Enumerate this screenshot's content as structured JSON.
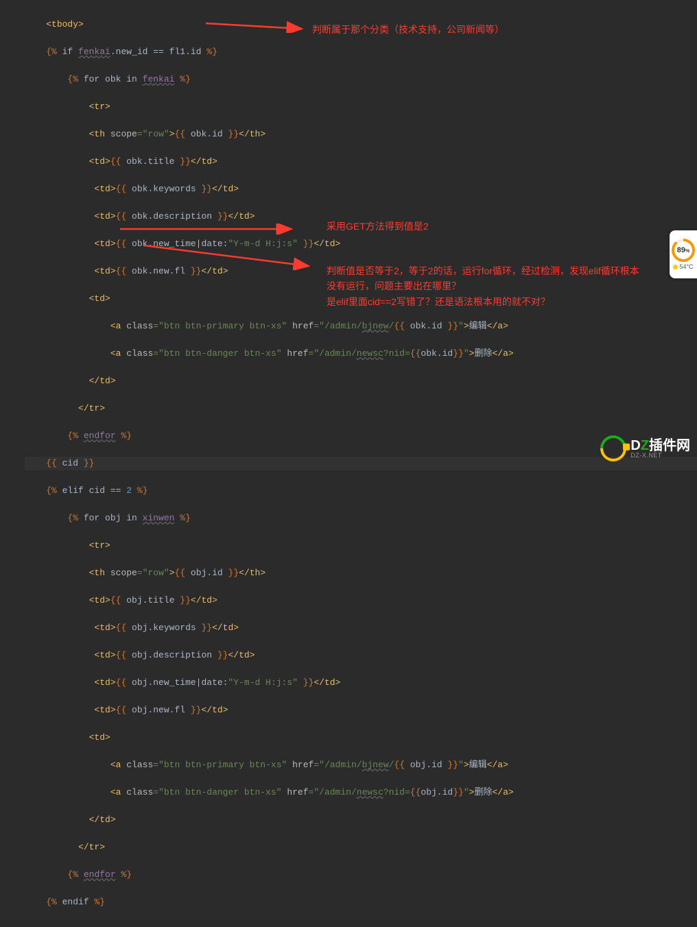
{
  "annotations": {
    "a1": "判断属于那个分类（技术支持，公司新闻等）",
    "a2": "采用GET方法得到值是2",
    "a3_l1": "判断值是否等于2，等于2的话，运行for循环，经过检测，发现elif循环根本",
    "a3_l2": "没有运行，问题主要出在哪里？",
    "a3_l3": "是elif里面cid==2写错了？还是语法根本用的就不对？"
  },
  "weather": {
    "score": "89",
    "unit": "%",
    "temp": "54°C"
  },
  "brand": {
    "main_pre": "D",
    "main_z": "Z",
    "main_post": "插件网",
    "sub": "DZ-X.NET"
  },
  "code": {
    "l1": "<tbody>",
    "l2_a": "{%",
    "l2_b": " if ",
    "l2_c": "fenkai",
    "l2_d": ".new_id == fl1.id ",
    "l2_e": "%}",
    "l3_a": "{%",
    "l3_b": " for obk in ",
    "l3_c": "fenkai",
    "l3_d": " ",
    "l3_e": "%}",
    "l4": "<tr>",
    "l5_a": "<th ",
    "l5_b": "scope",
    "l5_c": "=",
    "l5_d": "\"row\"",
    "l5_e": ">",
    "l5_f": "{{",
    "l5_g": " obk.id ",
    "l5_h": "}}",
    "l5_i": "</th>",
    "l6_a": "<td>",
    "l6_b": "{{",
    "l6_c": " obk.title ",
    "l6_d": "}}",
    "l6_e": "</td>",
    "l7_a": "<td>",
    "l7_b": "{{",
    "l7_c": " obk.keywords ",
    "l7_d": "}}",
    "l7_e": "</td>",
    "l8_a": "<td>",
    "l8_b": "{{",
    "l8_c": " obk.description ",
    "l8_d": "}}",
    "l8_e": "</td>",
    "l9_a": "<td>",
    "l9_b": "{{",
    "l9_c": " obk.new_time|date:",
    "l9_d": "\"Y-m-d H:j:s\"",
    "l9_e": " ",
    "l9_f": "}}",
    "l9_g": "</td>",
    "l10_a": "<td>",
    "l10_b": "{{",
    "l10_c": " obk.new.fl ",
    "l10_d": "}}",
    "l10_e": "</td>",
    "l11": "<td>",
    "l12_a": "<a ",
    "l12_b": "class",
    "l12_c": "=",
    "l12_d": "\"btn btn-primary btn-xs\"",
    "l12_e": " ",
    "l12_f": "href",
    "l12_g": "=",
    "l12_h": "\"/admin/",
    "l12_i": "bjnew",
    "l12_j": "/",
    "l12_k": "{{",
    "l12_l": " obk.id ",
    "l12_m": "}}",
    "l12_n": "\"",
    "l12_o": ">",
    "l12_p": "编辑",
    "l12_q": "</a>",
    "l13_a": "<a ",
    "l13_b": "class",
    "l13_c": "=",
    "l13_d": "\"btn btn-danger btn-xs\"",
    "l13_e": " ",
    "l13_f": "href",
    "l13_g": "=",
    "l13_h": "\"/admin/",
    "l13_i": "newsc",
    "l13_j": "?nid=",
    "l13_k": "{{",
    "l13_l": "obk.id",
    "l13_m": "}}",
    "l13_n": "\"",
    "l13_o": ">",
    "l13_p": "删除",
    "l13_q": "</a>",
    "l14": "</td>",
    "l15": "</tr>",
    "l16_a": "{%",
    "l16_b": " ",
    "l16_c": "endfor",
    "l16_d": " ",
    "l16_e": "%}",
    "l17_a": "{{",
    "l17_b": " cid ",
    "l17_c": "}}",
    "l18_a": "{%",
    "l18_b": " elif cid == ",
    "l18_c": "2",
    "l18_d": " ",
    "l18_e": "%}",
    "l19_a": "{%",
    "l19_b": " for obj in ",
    "l19_c": "xinwen",
    "l19_d": " ",
    "l19_e": "%}",
    "l20": "<tr>",
    "l21_a": "<th ",
    "l21_b": "scope",
    "l21_c": "=",
    "l21_d": "\"row\"",
    "l21_e": ">",
    "l21_f": "{{",
    "l21_g": " obj.id ",
    "l21_h": "}}",
    "l21_i": "</th>",
    "l22_a": "<td>",
    "l22_b": "{{",
    "l22_c": " obj.title ",
    "l22_d": "}}",
    "l22_e": "</td>",
    "l23_a": "<td>",
    "l23_b": "{{",
    "l23_c": " obj.keywords ",
    "l23_d": "}}",
    "l23_e": "</td>",
    "l24_a": "<td>",
    "l24_b": "{{",
    "l24_c": " obj.description ",
    "l24_d": "}}",
    "l24_e": "</td>",
    "l25_a": "<td>",
    "l25_b": "{{",
    "l25_c": " obj.new_time|date:",
    "l25_d": "\"Y-m-d H:j:s\"",
    "l25_e": " ",
    "l25_f": "}}",
    "l25_g": "</td>",
    "l26_a": "<td>",
    "l26_b": "{{",
    "l26_c": " obj.new.fl ",
    "l26_d": "}}",
    "l26_e": "</td>",
    "l27": "<td>",
    "l28_a": "<a ",
    "l28_b": "class",
    "l28_c": "=",
    "l28_d": "\"btn btn-primary btn-xs\"",
    "l28_e": " ",
    "l28_f": "href",
    "l28_g": "=",
    "l28_h": "\"/admin/",
    "l28_i": "bjnew",
    "l28_j": "/",
    "l28_k": "{{",
    "l28_l": " obj.id ",
    "l28_m": "}}",
    "l28_n": "\"",
    "l28_o": ">",
    "l28_p": "编辑",
    "l28_q": "</a>",
    "l29_a": "<a ",
    "l29_b": "class",
    "l29_c": "=",
    "l29_d": "\"btn btn-danger btn-xs\"",
    "l29_e": " ",
    "l29_f": "href",
    "l29_g": "=",
    "l29_h": "\"/admin/",
    "l29_i": "newsc",
    "l29_j": "?nid=",
    "l29_k": "{{",
    "l29_l": "obj.id",
    "l29_m": "}}",
    "l29_n": "\"",
    "l29_o": ">",
    "l29_p": "删除",
    "l29_q": "</a>",
    "l30": "</td>",
    "l31": "</tr>",
    "l32_a": "{%",
    "l32_b": " ",
    "l32_c": "endfor",
    "l32_d": " ",
    "l32_e": "%}",
    "l33_a": "{%",
    "l33_b": " endif ",
    "l33_c": "%}"
  }
}
